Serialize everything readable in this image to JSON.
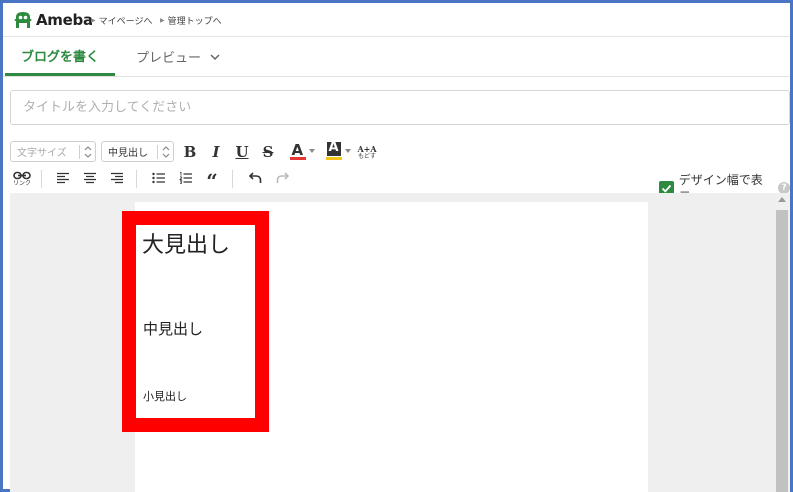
{
  "header": {
    "logo_text": "Ameba",
    "links": [
      {
        "label": "マイページへ"
      },
      {
        "label": "管理トップへ"
      }
    ]
  },
  "tabs": {
    "write": "ブログを書く",
    "preview": "プレビュー"
  },
  "title_input": {
    "placeholder": "タイトルを入力してください",
    "value": ""
  },
  "toolbar": {
    "font_size_select": "文字サイズ",
    "heading_select": "中見出し",
    "bold": "B",
    "italic": "I",
    "underline": "U",
    "strike": "S",
    "font_color": "A",
    "bg_color": "A",
    "reset_top": "A+A",
    "reset_bottom": "もどす",
    "link_label": "リンク",
    "quote": "“"
  },
  "design_width": {
    "label": "デザイン幅で表示",
    "checked": true,
    "help": "?"
  },
  "editor": {
    "large_heading": "大見出し",
    "medium_heading": "中見出し",
    "small_heading": "小見出し"
  },
  "colors": {
    "brand_green": "#2d8a3e",
    "highlight_red": "#ff0000",
    "font_color_bar": "#e53935",
    "bg_color_bar": "#f5c518",
    "frame_blue": "#4a74c4"
  }
}
